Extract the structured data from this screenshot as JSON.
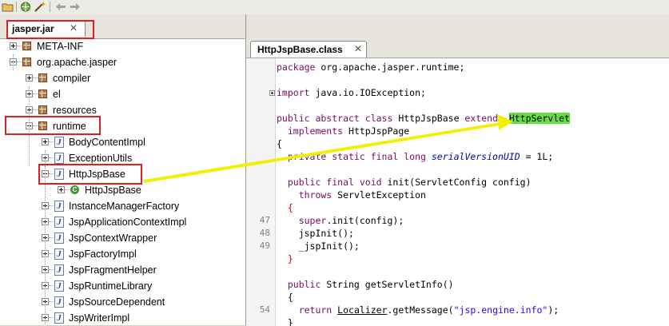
{
  "toolbar": {
    "icons": [
      "open-folder-icon",
      "open-url-icon",
      "wand-icon",
      "back-arrow-icon",
      "forward-arrow-icon"
    ]
  },
  "left_panel": {
    "tab": {
      "label": "jasper.jar",
      "close": "✕"
    },
    "tree": [
      {
        "label": "META-INF",
        "icon": "package-icon",
        "expander": "plus",
        "depth": 0
      },
      {
        "label": "org.apache.jasper",
        "icon": "package-icon",
        "expander": "minus",
        "depth": 0
      },
      {
        "label": "compiler",
        "icon": "package-icon",
        "expander": "plus",
        "depth": 1
      },
      {
        "label": "el",
        "icon": "package-icon",
        "expander": "plus",
        "depth": 1
      },
      {
        "label": "resources",
        "icon": "package-icon",
        "expander": "plus",
        "depth": 1
      },
      {
        "label": "runtime",
        "icon": "package-icon",
        "expander": "minus",
        "depth": 1
      },
      {
        "label": "BodyContentImpl",
        "icon": "java-file-icon",
        "expander": "plus",
        "depth": 2
      },
      {
        "label": "ExceptionUtils",
        "icon": "java-file-icon",
        "expander": "plus",
        "depth": 2
      },
      {
        "label": "HttpJspBase",
        "icon": "java-file-icon",
        "expander": "minus",
        "depth": 2
      },
      {
        "label": "HttpJspBase",
        "icon": "class-icon",
        "expander": "plus",
        "depth": 3
      },
      {
        "label": "InstanceManagerFactory",
        "icon": "java-file-icon",
        "expander": "plus",
        "depth": 2
      },
      {
        "label": "JspApplicationContextImpl",
        "icon": "java-file-icon",
        "expander": "plus",
        "depth": 2
      },
      {
        "label": "JspContextWrapper",
        "icon": "java-file-icon",
        "expander": "plus",
        "depth": 2
      },
      {
        "label": "JspFactoryImpl",
        "icon": "java-file-icon",
        "expander": "plus",
        "depth": 2
      },
      {
        "label": "JspFragmentHelper",
        "icon": "java-file-icon",
        "expander": "plus",
        "depth": 2
      },
      {
        "label": "JspRuntimeLibrary",
        "icon": "java-file-icon",
        "expander": "plus",
        "depth": 2
      },
      {
        "label": "JspSourceDependent",
        "icon": "java-file-icon",
        "expander": "plus",
        "depth": 2
      },
      {
        "label": "JspWriterImpl",
        "icon": "java-file-icon",
        "expander": "plus",
        "depth": 2
      }
    ]
  },
  "editor": {
    "tab": {
      "label": "HttpJspBase.class",
      "close": "✕"
    },
    "lines": [
      {
        "ln": "",
        "fold": false,
        "segments": [
          {
            "t": "package ",
            "c": "kw"
          },
          {
            "t": "org.apache.jasper.runtime;",
            "c": "tx"
          }
        ]
      },
      {
        "ln": "",
        "fold": false,
        "segments": []
      },
      {
        "ln": "",
        "fold": true,
        "segments": [
          {
            "t": "import ",
            "c": "kw"
          },
          {
            "t": "java.io.IOException;",
            "c": "tx"
          }
        ]
      },
      {
        "ln": "",
        "fold": false,
        "segments": []
      },
      {
        "ln": "",
        "fold": false,
        "segments": [
          {
            "t": "public abstract class ",
            "c": "kw"
          },
          {
            "t": "HttpJspBase ",
            "c": "tx"
          },
          {
            "t": "extends ",
            "c": "kw"
          },
          {
            "t": "HttpServlet",
            "c": "tx hl"
          }
        ]
      },
      {
        "ln": "",
        "fold": false,
        "segments": [
          {
            "t": "  implements ",
            "c": "kw"
          },
          {
            "t": "HttpJspPage",
            "c": "tx"
          }
        ]
      },
      {
        "ln": "",
        "fold": false,
        "segments": [
          {
            "t": "{",
            "c": "tx"
          }
        ]
      },
      {
        "ln": "",
        "fold": false,
        "segments": [
          {
            "t": "  private static final long ",
            "c": "kw"
          },
          {
            "t": "serialVersionUID",
            "c": "it"
          },
          {
            "t": " = 1L;",
            "c": "tx"
          }
        ]
      },
      {
        "ln": "",
        "fold": false,
        "segments": []
      },
      {
        "ln": "",
        "fold": false,
        "segments": [
          {
            "t": "  public final void ",
            "c": "kw"
          },
          {
            "t": "init(ServletConfig config)",
            "c": "tx"
          }
        ]
      },
      {
        "ln": "",
        "fold": false,
        "segments": [
          {
            "t": "    throws ",
            "c": "kw"
          },
          {
            "t": "ServletException",
            "c": "tx"
          }
        ]
      },
      {
        "ln": "",
        "fold": false,
        "segments": [
          {
            "t": "  {",
            "c": "brace-red"
          }
        ]
      },
      {
        "ln": "47",
        "fold": false,
        "segments": [
          {
            "t": "    super",
            "c": "kw"
          },
          {
            "t": ".init(config);",
            "c": "tx"
          }
        ]
      },
      {
        "ln": "48",
        "fold": false,
        "segments": [
          {
            "t": "    jspInit();",
            "c": "tx"
          }
        ]
      },
      {
        "ln": "49",
        "fold": false,
        "segments": [
          {
            "t": "    _jspInit();",
            "c": "tx"
          }
        ]
      },
      {
        "ln": "",
        "fold": false,
        "segments": [
          {
            "t": "  }",
            "c": "brace-red"
          }
        ]
      },
      {
        "ln": "",
        "fold": false,
        "segments": []
      },
      {
        "ln": "",
        "fold": false,
        "segments": [
          {
            "t": "  public ",
            "c": "kw"
          },
          {
            "t": "String getServletInfo()",
            "c": "tx"
          }
        ]
      },
      {
        "ln": "",
        "fold": false,
        "segments": [
          {
            "t": "  {",
            "c": "tx"
          }
        ]
      },
      {
        "ln": "54",
        "fold": false,
        "segments": [
          {
            "t": "    return ",
            "c": "kw"
          },
          {
            "t": "Localizer",
            "c": "tx ul"
          },
          {
            "t": ".",
            "c": "tx"
          },
          {
            "t": "getMessage",
            "c": "tx"
          },
          {
            "t": "(",
            "c": "tx"
          },
          {
            "t": "\"jsp.engine.info\"",
            "c": "str"
          },
          {
            "t": ");",
            "c": "tx"
          }
        ]
      },
      {
        "ln": "",
        "fold": false,
        "segments": [
          {
            "t": "  }",
            "c": "tx"
          }
        ]
      }
    ]
  },
  "annotations": {
    "color": "#e02020",
    "arrow_color": "#f0f000"
  }
}
